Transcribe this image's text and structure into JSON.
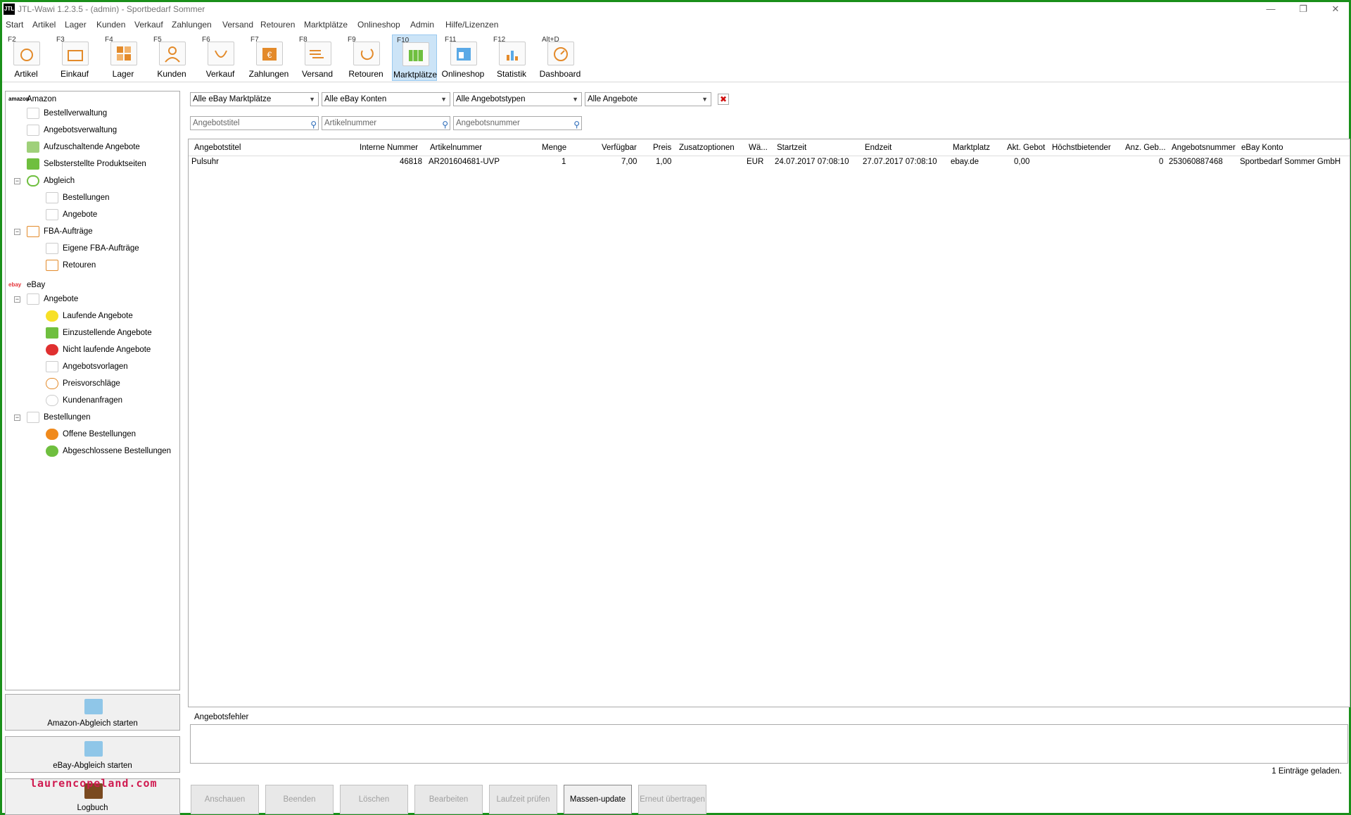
{
  "window": {
    "title": "JTL-Wawi 1.2.3.5 - (admin) - Sportbedarf Sommer",
    "logo": "JTL",
    "controls": [
      "—",
      "❐",
      "✕"
    ]
  },
  "menu": [
    "Start",
    "Artikel",
    "Lager",
    "Kunden",
    "Verkauf",
    "Zahlungen",
    "Versand",
    "Retouren",
    "Marktplätze",
    "Onlineshop",
    "Admin",
    "Hilfe/Lizenzen"
  ],
  "toolbar": [
    {
      "key": "F2",
      "label": "Artikel",
      "icon": "article-icon"
    },
    {
      "key": "F3",
      "label": "Einkauf",
      "icon": "purchase-icon"
    },
    {
      "key": "F4",
      "label": "Lager",
      "icon": "warehouse-icon"
    },
    {
      "key": "F5",
      "label": "Kunden",
      "icon": "customer-icon"
    },
    {
      "key": "F6",
      "label": "Verkauf",
      "icon": "sales-icon"
    },
    {
      "key": "F7",
      "label": "Zahlungen",
      "icon": "euro-icon"
    },
    {
      "key": "F8",
      "label": "Versand",
      "icon": "shipping-icon"
    },
    {
      "key": "F9",
      "label": "Retouren",
      "icon": "returns-icon"
    },
    {
      "key": "F10",
      "label": "Marktplätze",
      "icon": "marketplace-icon"
    },
    {
      "key": "F11",
      "label": "Onlineshop",
      "icon": "shop-icon"
    },
    {
      "key": "F12",
      "label": "Statistik",
      "icon": "chart-icon"
    },
    {
      "key": "Alt+D",
      "label": "Dashboard",
      "icon": "dashboard-icon"
    }
  ],
  "sidebar": {
    "amazon": {
      "label": "Amazon",
      "logo": "amazon",
      "items": [
        "Bestellverwaltung",
        "Angebotsverwaltung",
        "Aufzuschaltende Angebote",
        "Selbsterstellte Produktseiten"
      ],
      "abgleich": {
        "label": "Abgleich",
        "children": [
          "Bestellungen",
          "Angebote"
        ]
      },
      "fba": {
        "label": "FBA-Aufträge",
        "children": [
          "Eigene FBA-Aufträge",
          "Retouren"
        ]
      }
    },
    "ebay": {
      "label": "eBay",
      "logo": "ebay",
      "angebote": {
        "label": "Angebote",
        "children": [
          "Laufende Angebote",
          "Einzustellende Angebote",
          "Nicht laufende Angebote",
          "Angebotsvorlagen",
          "Preisvorschläge",
          "Kundenanfragen"
        ]
      },
      "bestellungen": {
        "label": "Bestellungen",
        "children": [
          "Offene Bestellungen",
          "Abgeschlossene Bestellungen"
        ]
      }
    },
    "buttons": [
      "Amazon-Abgleich starten",
      "eBay-Abgleich starten",
      "Logbuch"
    ]
  },
  "filters": {
    "combos": [
      "Alle eBay Marktplätze",
      "Alle eBay Konten",
      "Alle Angebotstypen",
      "Alle Angebote"
    ],
    "searches": [
      "Angebotstitel",
      "Artikelnummer",
      "Angebotsnummer"
    ]
  },
  "grid": {
    "columns": [
      "Angebotstitel",
      "Interne Nummer",
      "Artikelnummer",
      "Menge",
      "Verfügbar",
      "Preis",
      "Zusatzoptionen",
      "Wä...",
      "Startzeit",
      "Endzeit",
      "Marktplatz",
      "Akt. Gebot",
      "Höchstbietender",
      "Anz. Geb...",
      "Angebotsnummer",
      "eBay Konto"
    ],
    "rows": [
      [
        "Pulsuhr",
        "46818",
        "AR201604681-UVP",
        "1",
        "7,00",
        "1,00",
        "",
        "EUR",
        "24.07.2017 07:08:10",
        "27.07.2017 07:08:10",
        "ebay.de",
        "0,00",
        "",
        "0",
        "253060887468",
        "Sportbedarf Sommer GmbH"
      ]
    ]
  },
  "errors_label": "Angebotsfehler",
  "count_label": "1 Einträge geladen.",
  "actions": [
    {
      "label": "Anschauen",
      "enabled": false
    },
    {
      "label": "Beenden",
      "enabled": false
    },
    {
      "label": "Löschen",
      "enabled": false
    },
    {
      "label": "Bearbeiten",
      "enabled": false
    },
    {
      "label": "Laufzeit prüfen",
      "enabled": false
    },
    {
      "label": "Massen-update",
      "enabled": true
    },
    {
      "label": "Erneut übertragen",
      "enabled": false
    }
  ],
  "watermark": "laurencopeland.com",
  "colors": {
    "frame": "#1a8f1a",
    "active_tool": "#cce4f7",
    "clear": "#d01010"
  }
}
